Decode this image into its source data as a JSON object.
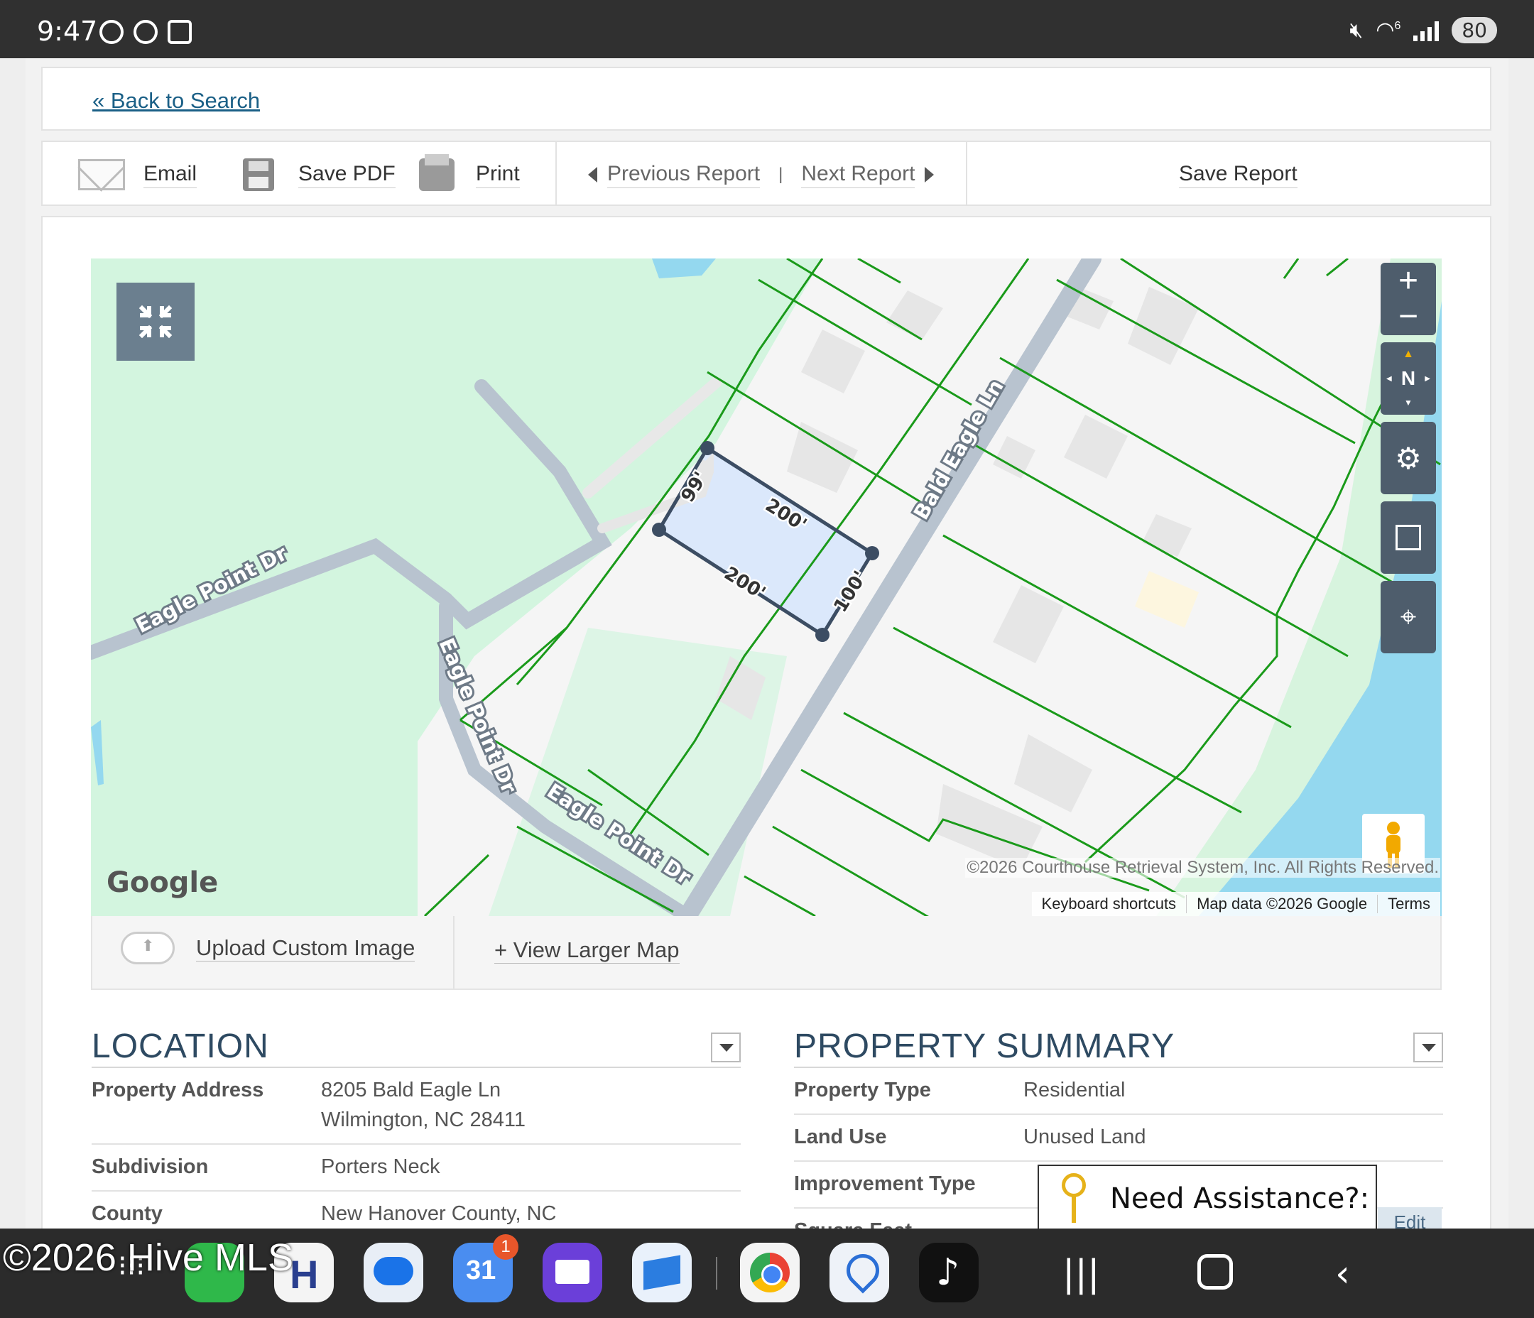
{
  "status_bar": {
    "time": "9:47",
    "battery": "80",
    "wifi_badge": "6"
  },
  "nav": {
    "back_to_search": "« Back to Search"
  },
  "toolbar": {
    "email": "Email",
    "save_pdf": "Save PDF",
    "print": "Print",
    "previous_report": "Previous Report",
    "separator": "|",
    "next_report": "Next Report",
    "save_report": "Save Report"
  },
  "map": {
    "streets": [
      "Eagle Point Dr",
      "Eagle Point Dr",
      "Eagle Point Dr",
      "Bald Eagle Ln"
    ],
    "parcel_dimensions": [
      "99'",
      "200'",
      "200'",
      "100'"
    ],
    "compass": "N",
    "google_logo": "Google",
    "copyright": "©2026 Courthouse Retrieval System, Inc. All Rights Reserved.",
    "attribution": [
      "Keyboard shortcuts",
      "Map data ©2026 Google",
      "Terms"
    ],
    "controls": [
      "zoom-in",
      "zoom-out",
      "compass",
      "settings",
      "draw-area",
      "locate"
    ]
  },
  "map_footer": {
    "upload": "Upload Custom Image",
    "view_larger": "+ View Larger Map"
  },
  "location": {
    "title": "LOCATION",
    "rows": [
      {
        "key": "Property Address",
        "value": "8205 Bald Eagle Ln",
        "value2": "Wilmington, NC 28411"
      },
      {
        "key": "Subdivision",
        "value": "Porters Neck"
      },
      {
        "key": "County",
        "value": "New Hanover County, NC"
      }
    ]
  },
  "summary": {
    "title": "PROPERTY SUMMARY",
    "rows": [
      {
        "key": "Property Type",
        "value": "Residential"
      },
      {
        "key": "Land Use",
        "value": "Unused Land"
      },
      {
        "key": "Improvement Type",
        "value": ""
      },
      {
        "key": "Square Feet",
        "value": ""
      }
    ],
    "edit": "Edit"
  },
  "assistance": {
    "label": "Need Assistance?:"
  },
  "watermark": "©2026 Hive MLS",
  "dock": {
    "apps": [
      "apps-grid",
      "phone",
      "hive-mls",
      "messages",
      "calendar",
      "email",
      "mail-app",
      "chrome",
      "maps-pin",
      "tiktok"
    ],
    "calendar_day": "31",
    "calendar_badge": "1"
  },
  "colors": {
    "parcel_line": "#1a9a1a",
    "selected_parcel": "#dbe8fb",
    "map_green": "#d3f5df",
    "water": "#94d8ef",
    "link": "#1a5f86",
    "heading": "#2e4a62",
    "control": "#4e5d6c"
  }
}
